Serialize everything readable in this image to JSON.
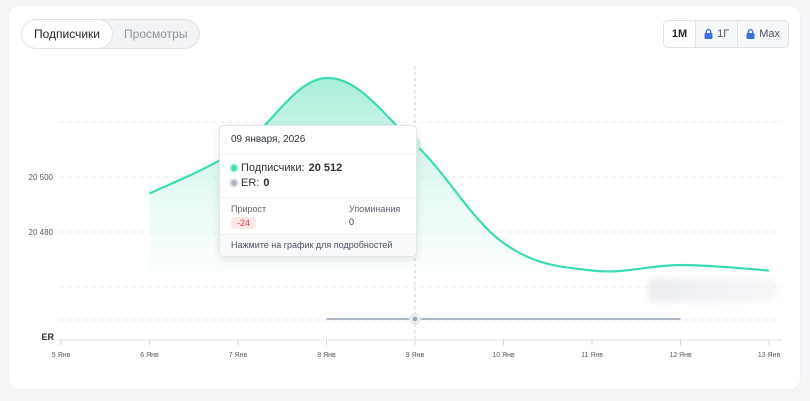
{
  "tabs": [
    {
      "label": "Подписчики",
      "active": true
    },
    {
      "label": "Просмотры",
      "active": false
    }
  ],
  "periods": [
    {
      "label": "1М",
      "active": true,
      "locked": false
    },
    {
      "label": "1Г",
      "active": false,
      "locked": true
    },
    {
      "label": "Max",
      "active": false,
      "locked": true
    }
  ],
  "colors": {
    "series": "#3ddbb4",
    "area": "#b6f1e1",
    "er_line": "#aeb7c2",
    "negative": "#d64545",
    "lock": "#3c6fe0"
  },
  "tooltip": {
    "date": "09 января, 2026",
    "series_label": "Подписчики:",
    "series_value": "20 512",
    "er_label": "ER:",
    "er_value": "0",
    "growth_label": "Прирост",
    "growth_value": "-24",
    "mentions_label": "Упоминания",
    "mentions_value": "0",
    "footer": "Нажмите на график для подробностей"
  },
  "chart_data": {
    "type": "area",
    "title": "",
    "x": [
      "5 Янв",
      "6 Янв",
      "7 Янв",
      "8 Янв",
      "9 Янв",
      "10 Янв",
      "11 Янв",
      "12 Янв",
      "13 Янв"
    ],
    "yticks": [
      20480,
      20500
    ],
    "ytick_labels": [
      "20 480",
      "20 500"
    ],
    "series": [
      {
        "name": "Подписчики",
        "x": [
          "6 Янв",
          "7 Янв",
          "8 Янв",
          "9 Янв",
          "10 Янв",
          "11 Янв",
          "12 Янв",
          "13 Янв"
        ],
        "values": [
          20494,
          20510,
          20536,
          20512,
          20476,
          20466,
          20468,
          20466
        ]
      }
    ],
    "er": {
      "label": "ER",
      "x": [
        "8 Янв",
        "9 Янв",
        "12 Янв"
      ],
      "values": [
        0,
        0,
        0
      ]
    },
    "crosshair_x": "9 Янв",
    "grid": true
  }
}
